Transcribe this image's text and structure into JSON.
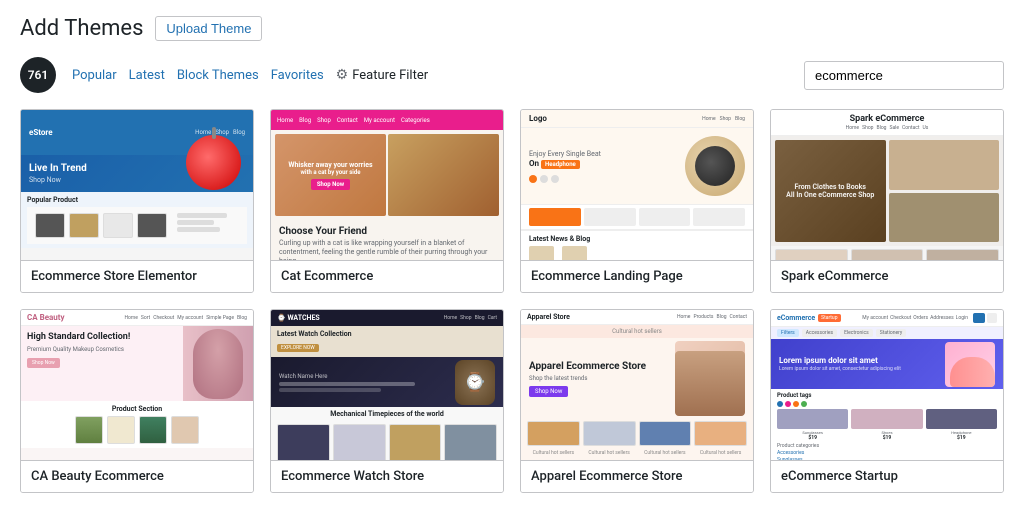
{
  "header": {
    "title": "Add Themes",
    "upload_button": "Upload Theme"
  },
  "filter_bar": {
    "count": "761",
    "links": [
      "Popular",
      "Latest",
      "Block Themes",
      "Favorites"
    ],
    "feature_filter": "Feature Filter",
    "search_placeholder": "ecommerce",
    "search_value": "ecommerce"
  },
  "themes": [
    {
      "id": "ecommerce-store-elementor",
      "name": "Ecommerce Store Elementor"
    },
    {
      "id": "cat-ecommerce",
      "name": "Cat Ecommerce"
    },
    {
      "id": "ecommerce-landing-page",
      "name": "Ecommerce Landing Page"
    },
    {
      "id": "spark-ecommerce",
      "name": "Spark eCommerce"
    },
    {
      "id": "ca-beauty-ecommerce",
      "name": "CA Beauty Ecommerce"
    },
    {
      "id": "ecommerce-watch-store",
      "name": "Ecommerce Watch Store"
    },
    {
      "id": "apparel-ecommerce-store",
      "name": "Apparel Ecommerce Store"
    },
    {
      "id": "ecommerce-startup",
      "name": "eCommerce Startup"
    }
  ],
  "colors": {
    "accent_blue": "#2271b1",
    "pink": "#e91e8c",
    "orange": "#f97316",
    "dark": "#1d2327",
    "purple": "#7c3aed",
    "startup_blue": "#4040cc"
  }
}
